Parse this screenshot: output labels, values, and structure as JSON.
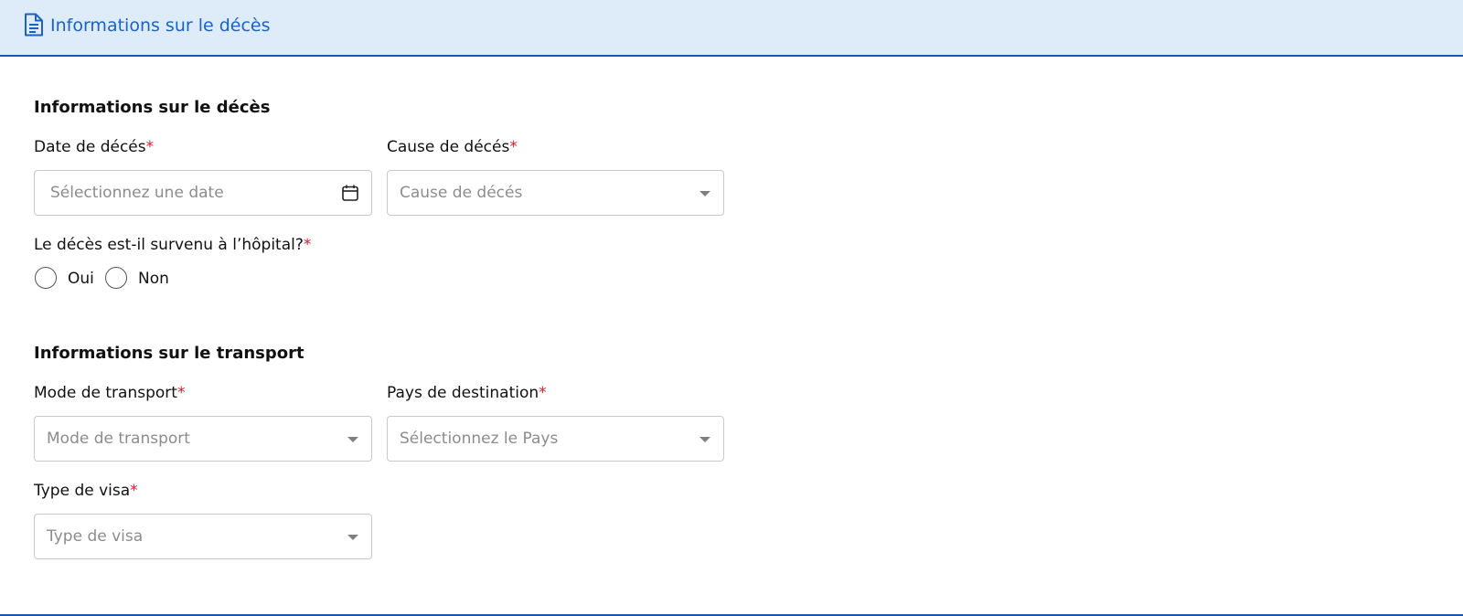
{
  "header": {
    "icon": "document-icon",
    "title": "Informations sur le décès"
  },
  "death_section": {
    "title": "Informations sur le décès",
    "date_field": {
      "label": "Date de décés",
      "required_mark": "*",
      "placeholder": "Sélectionnez une date",
      "icon": "calendar-icon"
    },
    "cause_field": {
      "label": "Cause de décés",
      "required_mark": "*",
      "placeholder": "Cause de décés"
    },
    "hospital_question": {
      "label": "Le décès est-il survenu à l’hôpital?",
      "required_mark": "*",
      "options": [
        "Oui",
        "Non"
      ]
    }
  },
  "transport_section": {
    "title": "Informations sur le transport",
    "mode_field": {
      "label": "Mode de transport",
      "required_mark": "*",
      "placeholder": "Mode de transport"
    },
    "country_field": {
      "label": "Pays de destination",
      "required_mark": "*",
      "placeholder": "Sélectionnez le Pays"
    },
    "visa_field": {
      "label": "Type de visa",
      "required_mark": "*",
      "placeholder": "Type de visa"
    }
  },
  "colors": {
    "accent": "#1a63c4",
    "header_bg": "#deebf8",
    "required": "#e0182d",
    "placeholder": "#8c8c8c"
  }
}
